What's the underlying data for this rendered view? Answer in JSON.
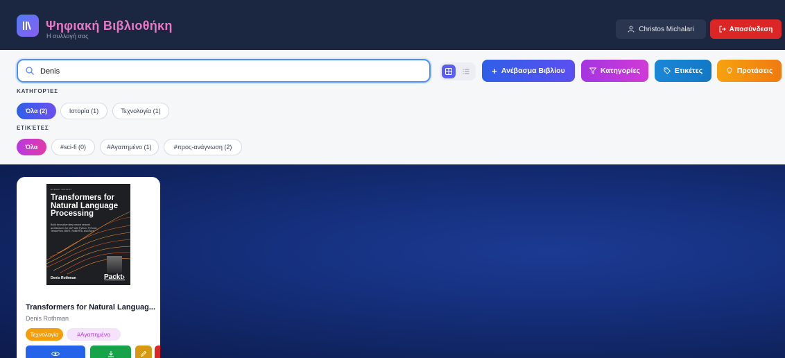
{
  "header": {
    "title": "Ψηφιακή Βιβλιοθήκη",
    "subtitle": "Η συλλογή σας",
    "user_name": "Christos Michalari",
    "logout_label": "Αποσύνδεση"
  },
  "search": {
    "value": "Denis",
    "placeholder": ""
  },
  "toolbar": {
    "upload_label": "Ανέβασμα Βιβλίου",
    "categories_label": "Κατηγορίες",
    "tags_label": "Ετικέτες",
    "suggestions_label": "Προτάσεις"
  },
  "filters": {
    "categories_heading": "ΚΑΤΗΓΟΡΊΕΣ",
    "categories": [
      "Όλα (2)",
      "Ιστορία (1)",
      "Τεχνολογία (1)"
    ],
    "tags_heading": "ΕΤΙΚΈΤΕΣ",
    "tags": [
      "Όλα",
      "#sci-fi (0)",
      "#Αγαπημένο (1)",
      "#προς-ανάγνωση (2)"
    ]
  },
  "books": [
    {
      "title": "Transformers for Natural Languag...",
      "author": "Denis Rothman",
      "category": "Τεχνολογία",
      "tag": "#Αγαπημένο",
      "cover": {
        "series": "EXPERT INSIGHT",
        "title": "Transformers for Natural Language Processing",
        "blurb": "Build innovative deep neural network architectures for NLP with Python, PyTorch, TensorFlow, BERT, RoBERTa, and more",
        "author": "Denis Rothman",
        "publisher": "Packt›"
      }
    }
  ],
  "colors": {
    "header_bg": "#1b2640",
    "accent_blue": "#2f5fe8",
    "accent_purple": "#a436e0",
    "accent_teal": "#1a87d6",
    "accent_orange": "#f7a20f",
    "danger": "#dc2626",
    "success": "#16a34a"
  }
}
